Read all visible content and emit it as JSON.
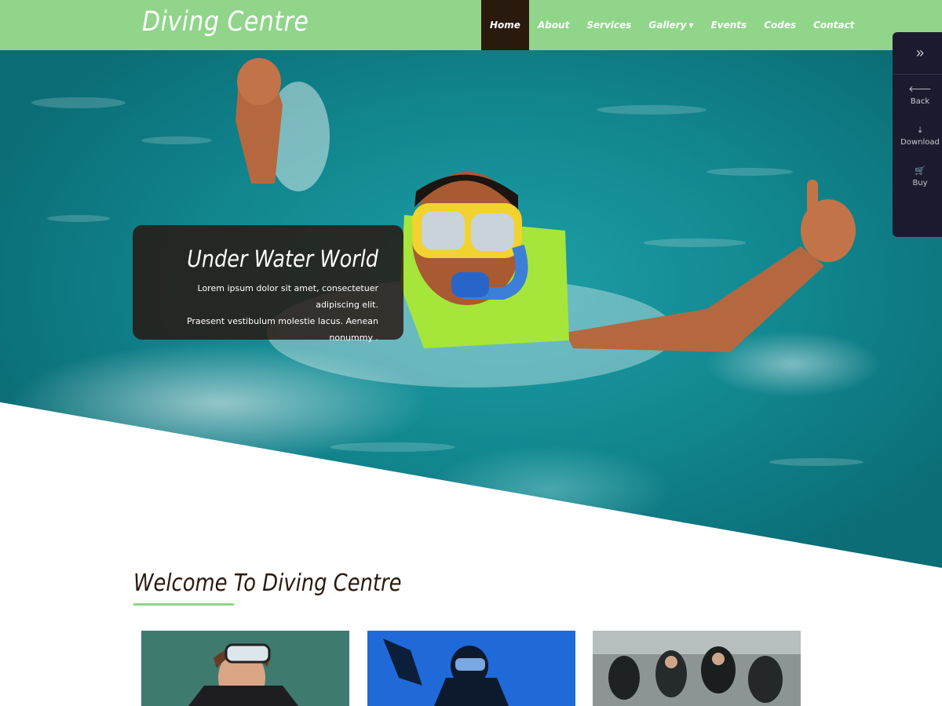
{
  "header": {
    "logo": "Diving Centre",
    "nav": [
      {
        "label": "Home",
        "active": true
      },
      {
        "label": "About"
      },
      {
        "label": "Services"
      },
      {
        "label": "Gallery",
        "has_dropdown": true
      },
      {
        "label": "Events"
      },
      {
        "label": "Codes"
      },
      {
        "label": "Contact"
      }
    ]
  },
  "hero": {
    "title": "Under Water World",
    "text_line1": "Lorem ipsum dolor sit amet, consectetuer adipiscing elit.",
    "text_line2": "Praesent vestibulum molestie lacus. Aenean nonummy ."
  },
  "side_panel": {
    "toggle_icon": "double-chevron-right-icon",
    "items": [
      {
        "label": "Back",
        "icon": "arrow-left-icon"
      },
      {
        "label": "Download",
        "icon": "download-icon"
      },
      {
        "label": "Buy",
        "icon": "cart-icon"
      }
    ]
  },
  "welcome": {
    "title": "Welcome To Diving Centre"
  },
  "colors": {
    "header_bg": "#90d58a",
    "active_nav_bg": "#2a1a0e",
    "accent": "#90d58a",
    "side_panel_bg": "#1c1a2e",
    "heading_text": "#2a1a0e"
  }
}
